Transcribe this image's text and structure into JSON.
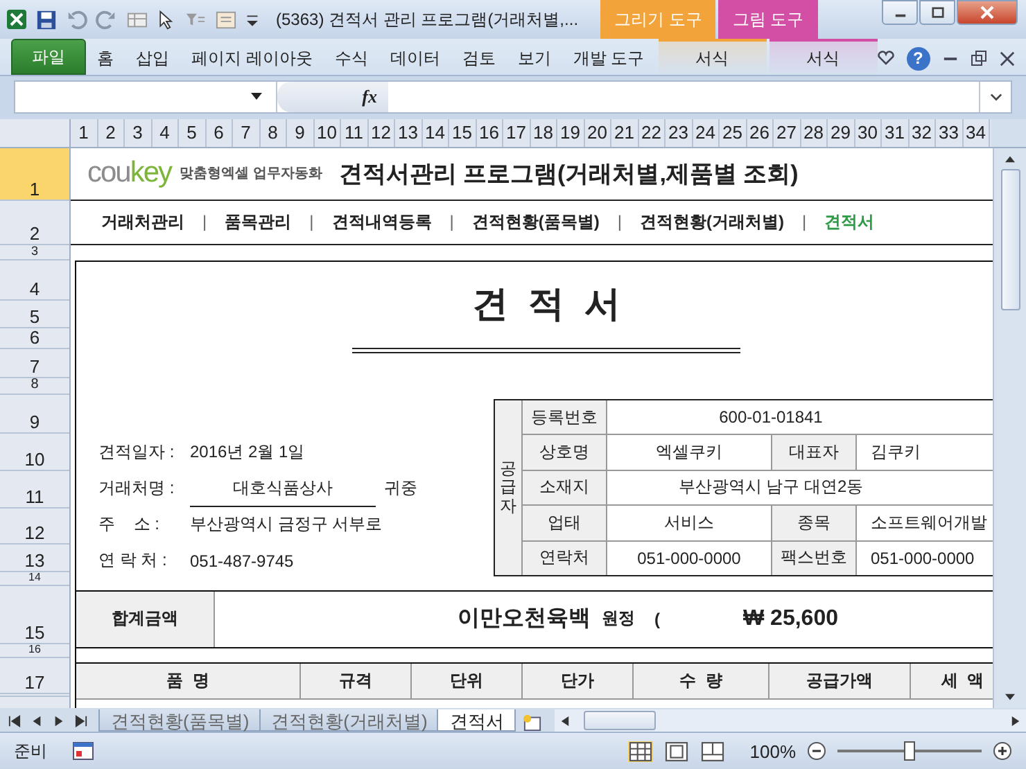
{
  "window": {
    "title": "(5363) 견적서 관리 프로그램(거래처별,..."
  },
  "context_tabs": [
    {
      "group": "그리기 도구",
      "tab": "서식",
      "color": "#f2a33a"
    },
    {
      "group": "그림 도구",
      "tab": "서식",
      "color": "#d24fa5"
    }
  ],
  "ribbon_tabs": [
    {
      "label": "파일",
      "kind": "file"
    },
    {
      "label": "홈",
      "kind": "tab"
    },
    {
      "label": "삽입",
      "kind": "tab"
    },
    {
      "label": "페이지 레이아웃",
      "kind": "tab"
    },
    {
      "label": "수식",
      "kind": "tab"
    },
    {
      "label": "데이터",
      "kind": "tab"
    },
    {
      "label": "검토",
      "kind": "tab"
    },
    {
      "label": "보기",
      "kind": "tab"
    },
    {
      "label": "개발 도구",
      "kind": "tab"
    }
  ],
  "formula_bar": {
    "fx": "fx"
  },
  "column_headers": [
    "1",
    "2",
    "3",
    "4",
    "5",
    "6",
    "7",
    "8",
    "9",
    "10",
    "11",
    "12",
    "13",
    "14",
    "15",
    "16",
    "17",
    "18",
    "19",
    "20",
    "21",
    "22",
    "23",
    "24",
    "25",
    "26",
    "27",
    "28",
    "29",
    "30",
    "31",
    "32",
    "33",
    "34"
  ],
  "row_headers": [
    {
      "label": "1",
      "selected": true
    },
    {
      "label": "2",
      "selected": false
    },
    {
      "label": "3",
      "selected": false
    },
    {
      "label": "4",
      "selected": false
    },
    {
      "label": "5",
      "selected": false
    },
    {
      "label": "6",
      "selected": false
    },
    {
      "label": "7",
      "selected": false
    },
    {
      "label": "8",
      "selected": false
    },
    {
      "label": "9",
      "selected": false
    },
    {
      "label": "10",
      "selected": false
    },
    {
      "label": "11",
      "selected": false
    },
    {
      "label": "12",
      "selected": false
    },
    {
      "label": "13",
      "selected": false
    },
    {
      "label": "14",
      "selected": false
    },
    {
      "label": "15",
      "selected": false
    },
    {
      "label": "16",
      "selected": false
    },
    {
      "label": "17",
      "selected": false
    }
  ],
  "banner": {
    "logo_grey": "cou",
    "logo_green": "key",
    "tagline": "맞춤형엑셀 업무자동화",
    "title": "견적서관리 프로그램(거래처별,제품별 조회)"
  },
  "nav": [
    {
      "label": "거래처관리",
      "selected": false
    },
    {
      "label": "품목관리",
      "selected": false
    },
    {
      "label": "견적내역등록",
      "selected": false
    },
    {
      "label": "견적현황(품목별)",
      "selected": false
    },
    {
      "label": "견적현황(거래처별)",
      "selected": false
    },
    {
      "label": "견적서",
      "selected": true
    }
  ],
  "nav_separator": "|",
  "form": {
    "title": "견  적  서",
    "info": [
      {
        "label": "견적일자 :",
        "value": "2016년 2월 1일",
        "kind": "plain"
      },
      {
        "label": "거래처명 :",
        "value": "대호식품상사",
        "suffix": "귀중",
        "kind": "underlined"
      },
      {
        "label": "주    소 :",
        "value": "부산광역시 금정구 서부로",
        "kind": "plain"
      },
      {
        "label": "연 락 처 :",
        "value": "051-487-9745",
        "kind": "plain"
      }
    ],
    "supplier": {
      "side_label": "공급자",
      "rows": [
        [
          {
            "label": "등록번호",
            "value": "600-01-01841"
          }
        ],
        [
          {
            "label": "상호명",
            "value": "엑셀쿠키"
          },
          {
            "label": "대표자",
            "value": "김쿠키"
          }
        ],
        [
          {
            "label": "소재지",
            "value": "부산광역시 남구 대연2동"
          }
        ],
        [
          {
            "label": "업태",
            "value": "서비스"
          },
          {
            "label": "종목",
            "value": "소프트웨어개발"
          }
        ],
        [
          {
            "label": "연락처",
            "value": "051-000-0000"
          },
          {
            "label": "팩스번호",
            "value": "051-000-0000"
          }
        ]
      ]
    },
    "total": {
      "label": "합계금액",
      "amount_words": "이만오천육백",
      "won": "원정",
      "paren": "(",
      "amount": "₩ 25,600"
    },
    "item_columns": [
      "품  명",
      "규격",
      "단위",
      "단가",
      "수  량",
      "공급가액",
      "세  액"
    ]
  },
  "sheet_tabs": [
    {
      "label": "견적현황(품목별)",
      "selected": false
    },
    {
      "label": "견적현황(거래처별)",
      "selected": false
    },
    {
      "label": "견적서",
      "selected": true
    }
  ],
  "help": "?",
  "status_bar": {
    "status": "준비",
    "zoom": "100%",
    "zoom_slider": {
      "level": 0.5
    }
  }
}
